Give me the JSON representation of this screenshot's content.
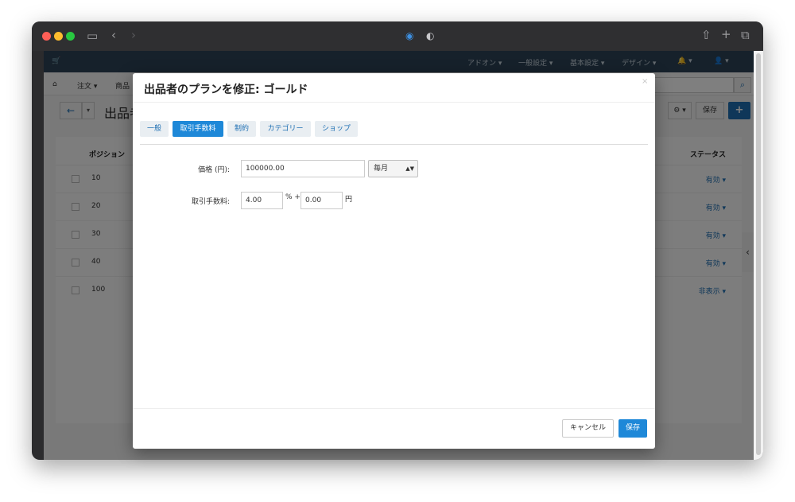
{
  "browser": {
    "traffic_colors": [
      "#ff5f57",
      "#febc2e",
      "#28c840"
    ]
  },
  "topnav": {
    "items": [
      "アドオン ▾",
      "一般設定 ▾",
      "基本設定 ▾",
      "デザイン ▾"
    ]
  },
  "subnav": {
    "items": [
      "注文 ▾",
      "商品"
    ]
  },
  "page": {
    "title_partial": "出品者の",
    "save_label": "保存"
  },
  "bg_table": {
    "headers": {
      "position": "ポジション",
      "status": "ステータス"
    },
    "rows": [
      {
        "position": "10",
        "status": "有効 ▾"
      },
      {
        "position": "20",
        "status": "有効 ▾"
      },
      {
        "position": "30",
        "status": "有効 ▾"
      },
      {
        "position": "40",
        "status": "有効 ▾"
      },
      {
        "position": "100",
        "status": "非表示 ▾"
      }
    ]
  },
  "modal": {
    "title": "出品者のプランを修正: ゴールド",
    "close_label": "×",
    "tabs": [
      "一般",
      "取引手数料",
      "制約",
      "カテゴリー",
      "ショップ"
    ],
    "active_tab": "取引手数料",
    "price": {
      "label": "価格 (円):",
      "value": "100000.00",
      "period": "毎月"
    },
    "commission": {
      "label": "取引手数料:",
      "percent_value": "4.00",
      "percent_suffix": "% +",
      "fixed_value": "0.00",
      "fixed_suffix": "円"
    },
    "cancel_label": "キャンセル",
    "save_label": "保存"
  },
  "colors": {
    "primary": "#1e88d8",
    "link": "#1e6fb3",
    "topnav": "#2d4356"
  }
}
